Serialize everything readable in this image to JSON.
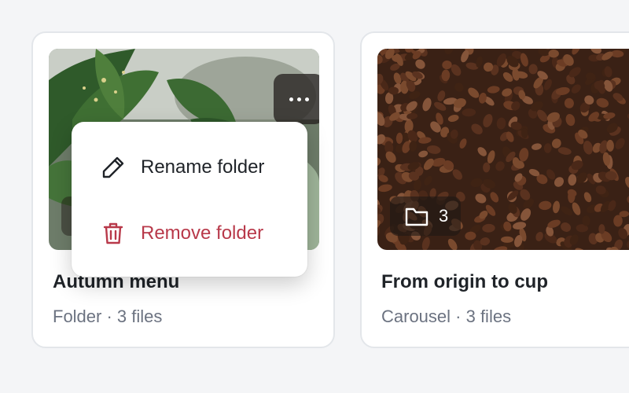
{
  "cards": [
    {
      "title": "Autumn menu",
      "meta": "Folder · 3 files"
    },
    {
      "title": "From origin to cup",
      "meta": "Carousel · 3 files",
      "count": "3"
    }
  ],
  "menu": {
    "rename_label": "Rename folder",
    "remove_label": "Remove folder"
  },
  "icons": {
    "more": "more-horizontal-icon",
    "folder": "folder-icon",
    "rename": "pencil-icon",
    "remove": "trash-icon"
  },
  "colors": {
    "danger": "#b8394a",
    "text": "#1f2328",
    "muted": "#6b7280"
  }
}
